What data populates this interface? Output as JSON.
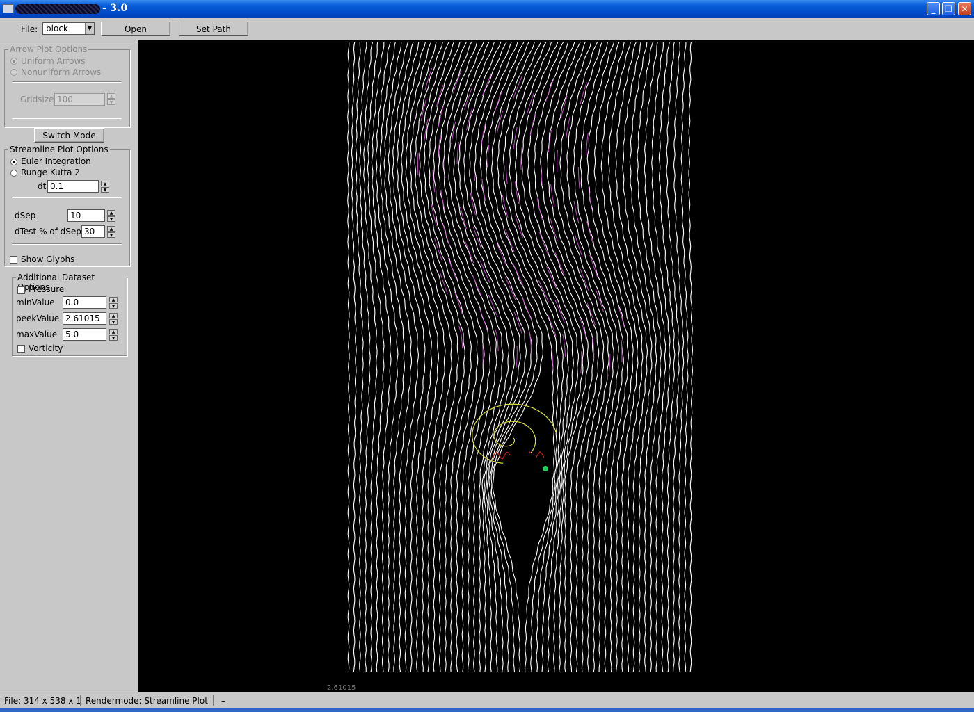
{
  "window": {
    "title": "- 3.0",
    "minimize_glyph": "_",
    "restore_glyph": "❐",
    "close_glyph": "✕"
  },
  "toolbar": {
    "file_label": "File:",
    "file_value": "block",
    "open_label": "Open",
    "setpath_label": "Set Path"
  },
  "arrow_options": {
    "legend": "Arrow Plot Options",
    "uniform": "Uniform Arrows",
    "nonuniform": "Nonuniform Arrows",
    "gridsize_label": "Gridsize",
    "gridsize_value": "100"
  },
  "switch_mode_label": "Switch Mode",
  "streamline_options": {
    "legend": "Streamline Plot Options",
    "euler": "Euler Integration",
    "rk2": "Runge Kutta 2",
    "dt_label": "dt",
    "dt_value": "0.1",
    "dsep_label": "dSep",
    "dsep_value": "10",
    "dtest_label": "dTest % of dSep",
    "dtest_value": "30",
    "show_glyphs": "Show Glyphs"
  },
  "dataset_options": {
    "legend": "Additional Dataset Options",
    "pressure": "Pressure",
    "min_label": "minValue",
    "min_value": "0.0",
    "peek_label": "peekValue",
    "peek_value": "2.61015",
    "max_label": "maxValue",
    "max_value": "5.0",
    "vorticity": "Vorticity"
  },
  "canvas": {
    "peek_readout": "2.61015",
    "line_color": "#ffffff",
    "magenta": "#c050c0",
    "yellow": "#d8e040",
    "red": "#d02020",
    "green": "#20d060"
  },
  "status": {
    "file_info": "File: 314 x 538 x 1",
    "rendermode": "Rendermode: Streamline Plot",
    "extra": "–"
  }
}
